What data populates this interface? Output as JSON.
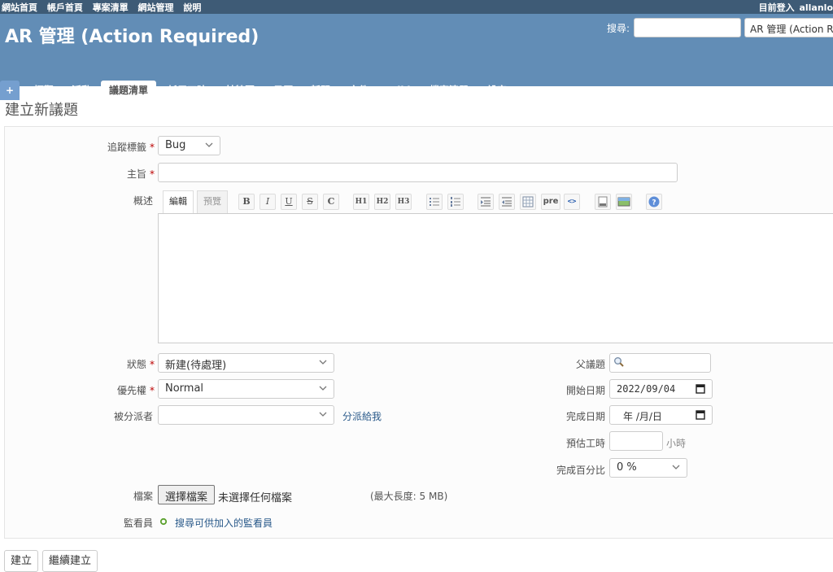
{
  "top_menu": {
    "links": [
      "網站首頁",
      "帳戶首頁",
      "專案清單",
      "網站管理",
      "說明"
    ],
    "login_label": "目前登入",
    "login_user": "allanlo"
  },
  "header": {
    "title": "AR 管理 (Action Required)",
    "search_label": "搜尋:",
    "search_value": "",
    "project_select": "AR 管理 (Action R"
  },
  "main_menu": {
    "plus": "+",
    "tabs": [
      "概觀",
      "活動",
      "議題清單",
      "耗用工時",
      "甘特圖",
      "日曆",
      "新聞",
      "文件",
      "Wiki",
      "檔案清單",
      "設定"
    ],
    "selected": "議題清單"
  },
  "page": {
    "title": "建立新議題"
  },
  "form": {
    "tracker_label": "追蹤標籤",
    "tracker_value": "Bug",
    "subject_label": "主旨",
    "subject_value": "",
    "description_label": "概述",
    "editor_tab_edit": "編輯",
    "editor_tab_preview": "預覽",
    "toolbar": [
      "B",
      "I",
      "U",
      "S",
      "C",
      "H1",
      "H2",
      "H3",
      "ul",
      "ol",
      "indent-right",
      "indent-left",
      "table",
      "pre",
      "<>",
      "image",
      "img",
      "?"
    ],
    "status_label": "狀態",
    "status_value": "新建(待處理)",
    "priority_label": "優先權",
    "priority_value": "Normal",
    "assignee_label": "被分派者",
    "assignee_value": "",
    "assign_to_me": "分派給我",
    "parent_label": "父議題",
    "start_label": "開始日期",
    "start_value": "2022/09/04",
    "due_label": "完成日期",
    "due_value": "年 /月/日",
    "estimate_label": "預估工時",
    "estimate_value": "",
    "estimate_unit": "小時",
    "done_label": "完成百分比",
    "done_value": "0 %",
    "files_label": "檔案",
    "choose_file": "選擇檔案",
    "no_file": "未選擇任何檔案",
    "max_size": "(最大長度: 5 MB)",
    "watchers_label": "監看員",
    "search_watchers": "搜尋可供加入的監看員"
  },
  "buttons": {
    "create": "建立",
    "create_continue": "繼續建立"
  },
  "colors": {
    "top_bar": "#3e5b76",
    "header": "#628db6",
    "required": "#bb0000",
    "link": "#2a5a8a"
  }
}
